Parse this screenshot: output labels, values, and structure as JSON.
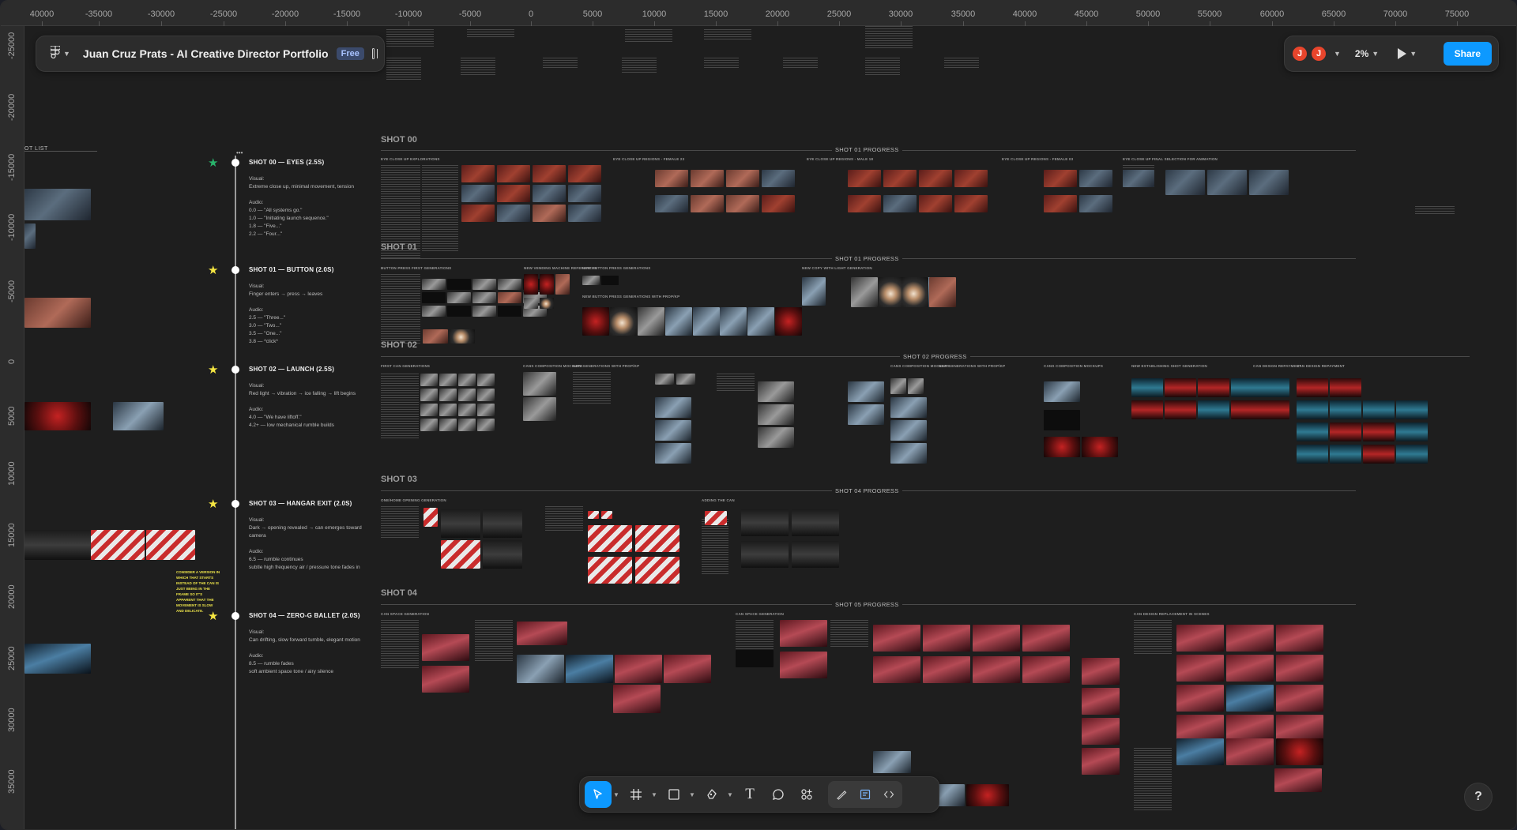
{
  "app": {
    "file_title": "Juan Cruz Prats - AI Creative Director Portfolio",
    "plan_badge": "Free",
    "zoom": "2%",
    "share_label": "Share",
    "avatars": [
      "J",
      "J"
    ],
    "accent_color": "#0d99ff",
    "help_label": "?"
  },
  "ruler": {
    "top_ticks": [
      "40000",
      "-35000",
      "-30000",
      "-25000",
      "-20000",
      "-15000",
      "-10000",
      "-5000",
      "0",
      "5000",
      "10000",
      "15000",
      "20000",
      "25000",
      "30000",
      "35000",
      "40000",
      "45000",
      "50000",
      "55000",
      "60000",
      "65000",
      "70000",
      "75000"
    ],
    "left_ticks": [
      "-25000",
      "-20000",
      "-15000",
      "-10000",
      "-5000",
      "0",
      "5000",
      "10000",
      "15000",
      "20000",
      "25000",
      "30000",
      "35000"
    ]
  },
  "toolbar": {
    "tools": [
      {
        "name": "move-tool",
        "icon": "pointer-icon"
      },
      {
        "name": "frame-tool",
        "icon": "frame-icon"
      },
      {
        "name": "shape-tool",
        "icon": "rectangle-icon"
      },
      {
        "name": "pen-tool",
        "icon": "pen-icon"
      },
      {
        "name": "text-tool",
        "icon": "text-icon",
        "glyph": "T"
      },
      {
        "name": "comment-tool",
        "icon": "comment-icon"
      },
      {
        "name": "actions-tool",
        "icon": "actions-icon"
      }
    ],
    "mode_tools": [
      "draw-mode-icon",
      "design-mode-icon",
      "dev-mode-icon"
    ]
  },
  "canvas": {
    "shot_list_label": "OT LIST",
    "shots": [
      {
        "title": "SHOT 00 — EYES (2.5S)",
        "body": "Visual:\nExtreme close up, minimal movement, tension\n\nAudio:\n0.0 — \"All systems go.\"\n1.0 — \"Initiating launch sequence.\"\n1.8 — \"Five...\"\n2.2 — \"Four...\"",
        "star_color": "#29b36b"
      },
      {
        "title": "SHOT 01 — BUTTON (2.0S)",
        "body": "Visual:\nFinger enters → press → leaves\n\nAudio:\n2.5 — \"Three...\"\n3.0 — \"Two...\"\n3.5 — \"One...\"\n3.8 — *click*",
        "star_color": "#f5e642"
      },
      {
        "title": "SHOT 02 — LAUNCH (2.5S)",
        "body": "Visual:\nRed light → vibration → ice falling → lift begins\n\nAudio:\n4.0 — \"We have liftoff.\"\n4.2+ — low mechanical rumble builds",
        "star_color": "#f5e642"
      },
      {
        "title": "SHOT 03 — HANGAR EXIT (2.0S)",
        "body": "Visual:\nDark → opening revealed → can emerges toward camera\n\nAudio:\n6.5 — rumble continues\nsubtle high frequency air / pressure tone fades in",
        "star_color": "#f5e642"
      },
      {
        "title": "SHOT 04 — ZERO-G BALLET (2.0S)",
        "body": "Visual:\nCan drifting, slow forward tumble, elegant motion\n\nAudio:\n8.5 — rumble fades\nsoft ambient space tone / airy silence",
        "star_color": "#f5e642"
      }
    ],
    "yellow_note": "CONSIDER A VERSION IN WHICH THAT STARTS INSTEAD OF THE CAN IS JUST BEING IN THE FRAME SO IT'S APPARENT THAT THE MOVEMENT IS SLOW AND DELICATE.",
    "sections": [
      "SHOT 00",
      "SHOT 01",
      "SHOT 02",
      "SHOT 03",
      "SHOT 04"
    ],
    "progress_labels": [
      "SHOT 01 PROGRESS",
      "SHOT 01 PROGRESS",
      "SHOT 02 PROGRESS",
      "SHOT 04 PROGRESS",
      "SHOT 05 PROGRESS"
    ],
    "mini_headers": {
      "s0": [
        "EYE CLOSE UP EXPLORATIONS",
        "EYE CLOSE UP REGIONS - FEMALE 23",
        "EYE CLOSE UP REGIONS - MALE 18",
        "EYE CLOSE UP REGIONS - FEMALE 03",
        "EYE CLOSE UP FINAL SELECTION FOR ANIMATION"
      ],
      "s1": [
        "BUTTON PRESS FIRST GENERATIONS",
        "NEW VENDING MACHINE REFERENCES",
        "NEW BUTTON PRESS GENERATIONS",
        "NEW BUTTON PRESS GENERATIONS WITH PROP/KP",
        "NEW COPY WITH LIGHT GENERATION"
      ],
      "s2": [
        "FIRST CAN GENERATIONS",
        "CANS COMPOSITION MOCKUPS",
        "NEW GENERATIONS WITH PROP/KP",
        "CANS COMPOSITION MOCKUPS",
        "NEW GENERATIONS WITH PROP/KP",
        "CANS COMPOSITION MOCKUPS",
        "NEW ESTABLISHING SHOT GENERATION",
        "CAN DESIGN REPAYMENT",
        "CAN DESIGN REPAYMENT"
      ],
      "s3": [
        "ONE/HOME OPENING GENERATION",
        "ADDING THE CAN"
      ],
      "s4": [
        "CAN SPACE GENERATION",
        "CAN SPACE GENERATION",
        "CAN DESIGN REPLACEMENT IN SCENES"
      ]
    }
  }
}
